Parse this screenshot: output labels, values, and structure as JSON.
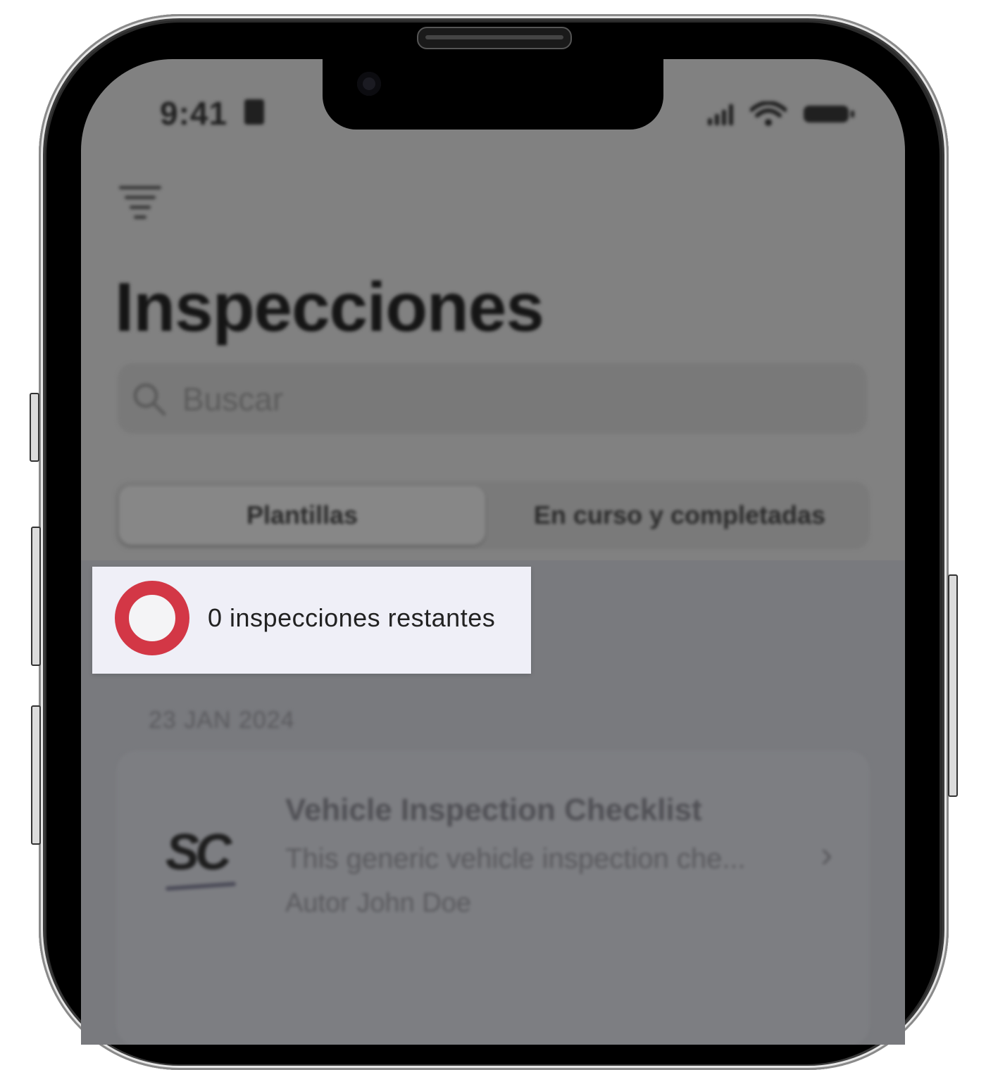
{
  "status_bar": {
    "time": "9:41"
  },
  "header": {
    "title": "Inspecciones"
  },
  "search": {
    "placeholder": "Buscar"
  },
  "tabs": [
    {
      "label": "Plantillas",
      "active": true
    },
    {
      "label": "En curso y completadas",
      "active": false
    }
  ],
  "counter": {
    "text": "0 inspecciones restantes",
    "ring_color": "#d33746"
  },
  "list": {
    "date_header": "23 JAN 2024",
    "items": [
      {
        "logo_text": "SC",
        "title": "Vehicle Inspection Checklist",
        "description": "This generic vehicle inspection che...",
        "author": "Autor John Doe"
      }
    ]
  },
  "icons": {
    "filter": "filter-icon",
    "search": "search-icon",
    "chevron": "chevron-right-icon"
  }
}
